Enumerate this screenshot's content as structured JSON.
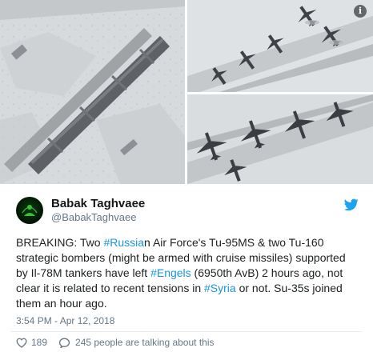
{
  "media": {
    "images": [
      {
        "name": "airfield-runway-satellite-image"
      },
      {
        "name": "parked-bombers-satellite-image-1"
      },
      {
        "name": "parked-bombers-satellite-image-2"
      }
    ],
    "info_symbol": "i"
  },
  "author": {
    "display_name": "Babak Taghvaee",
    "handle": "@BabakTaghvaee"
  },
  "tweet": {
    "lines": [
      [
        {
          "text": "BREAKING: Two "
        },
        {
          "text": "#Russia",
          "hashtag": true
        },
        {
          "text": "n Air Force's Tu-95MS & two Tu-160"
        }
      ],
      [
        {
          "text": "strategic bombers (might be armed with cruise missiles) supported"
        }
      ],
      [
        {
          "text": "by Il-78M tankers have left "
        },
        {
          "text": "#Engels",
          "hashtag": true
        },
        {
          "text": " (6950th AvB) 2 hours ago, not"
        }
      ],
      [
        {
          "text": "clear it is related to recent tensions in "
        },
        {
          "text": "#Syria",
          "hashtag": true
        },
        {
          "text": " or not. Su-35s joined"
        }
      ],
      [
        {
          "text": "them an hour ago."
        }
      ]
    ],
    "timestamp": "3:54 PM - Apr 12, 2018"
  },
  "actions": {
    "likes": "189",
    "talking": "245 people are talking about this"
  },
  "colors": {
    "link": "#1b95e0",
    "secondary_text": "#657786",
    "twitter_blue": "#1da1f2"
  }
}
